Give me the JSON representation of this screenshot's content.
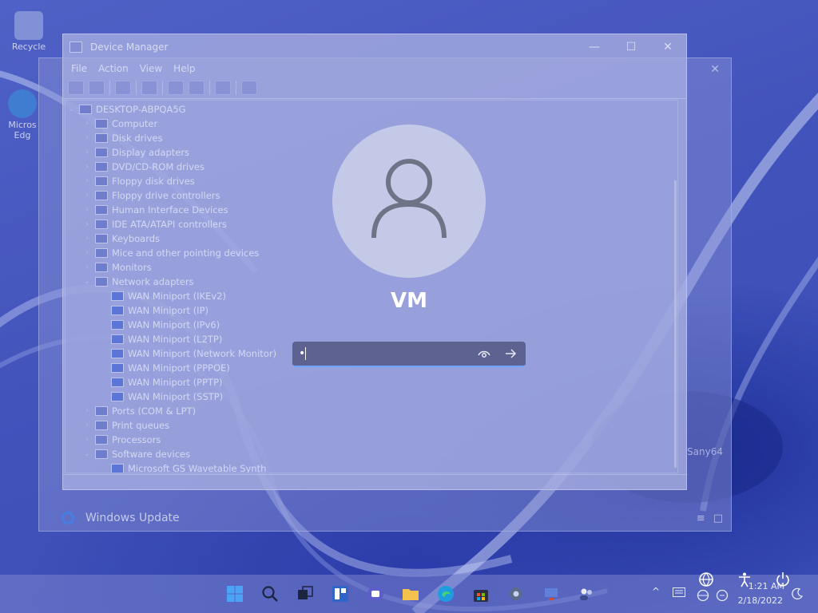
{
  "desktop": {
    "icons": [
      {
        "label": "Recycle"
      },
      {
        "label": "Micros Edg"
      }
    ]
  },
  "background_window": {
    "footer_label": "Windows Update",
    "side_text": "Sany64",
    "close_glyph": "✕",
    "corner_glyphs": [
      "≡",
      "□"
    ]
  },
  "device_manager": {
    "title": "Device Manager",
    "controls": {
      "minimize": "—",
      "maximize": "☐",
      "close": "✕"
    },
    "menu": [
      "File",
      "Action",
      "View",
      "Help"
    ],
    "tree": {
      "root": "DESKTOP-ABPQA5G",
      "items": [
        {
          "label": "Computer",
          "level": 1,
          "expander": "›"
        },
        {
          "label": "Disk drives",
          "level": 1,
          "expander": "›"
        },
        {
          "label": "Display adapters",
          "level": 1,
          "expander": "›"
        },
        {
          "label": "DVD/CD-ROM drives",
          "level": 1,
          "expander": "›"
        },
        {
          "label": "Floppy disk drives",
          "level": 1,
          "expander": "›"
        },
        {
          "label": "Floppy drive controllers",
          "level": 1,
          "expander": "›"
        },
        {
          "label": "Human Interface Devices",
          "level": 1,
          "expander": "›"
        },
        {
          "label": "IDE ATA/ATAPI controllers",
          "level": 1,
          "expander": "›"
        },
        {
          "label": "Keyboards",
          "level": 1,
          "expander": "›"
        },
        {
          "label": "Mice and other pointing devices",
          "level": 1,
          "expander": "›"
        },
        {
          "label": "Monitors",
          "level": 1,
          "expander": "›"
        },
        {
          "label": "Network adapters",
          "level": 1,
          "expander": "⌄"
        },
        {
          "label": "WAN Miniport (IKEv2)",
          "level": 2,
          "expander": ""
        },
        {
          "label": "WAN Miniport (IP)",
          "level": 2,
          "expander": ""
        },
        {
          "label": "WAN Miniport (IPv6)",
          "level": 2,
          "expander": ""
        },
        {
          "label": "WAN Miniport (L2TP)",
          "level": 2,
          "expander": ""
        },
        {
          "label": "WAN Miniport (Network Monitor)",
          "level": 2,
          "expander": ""
        },
        {
          "label": "WAN Miniport (PPPOE)",
          "level": 2,
          "expander": ""
        },
        {
          "label": "WAN Miniport (PPTP)",
          "level": 2,
          "expander": ""
        },
        {
          "label": "WAN Miniport (SSTP)",
          "level": 2,
          "expander": ""
        },
        {
          "label": "Ports (COM & LPT)",
          "level": 1,
          "expander": "›"
        },
        {
          "label": "Print queues",
          "level": 1,
          "expander": "›"
        },
        {
          "label": "Processors",
          "level": 1,
          "expander": "›"
        },
        {
          "label": "Software devices",
          "level": 1,
          "expander": "⌄"
        },
        {
          "label": "Microsoft GS Wavetable Synth",
          "level": 2,
          "expander": ""
        }
      ]
    }
  },
  "lock_screen": {
    "username": "VM",
    "password_masked": "•",
    "icons": {
      "avatar": "user-icon",
      "reveal": "eye-icon",
      "submit": "arrow-right-icon"
    },
    "accent": "#6fa3ff"
  },
  "taskbar": {
    "apps": [
      "windows-start-icon",
      "search-icon",
      "task-view-icon",
      "widgets-icon",
      "chat-icon",
      "file-explorer-icon",
      "edge-icon",
      "store-icon",
      "settings-icon",
      "device-manager-icon",
      "people-icon"
    ],
    "tray": {
      "chevron": "^",
      "clock_time": "1:21 AM",
      "clock_date": "2/18/2022"
    }
  },
  "lock_corner_icons": [
    "network-icon",
    "accessibility-icon",
    "power-icon"
  ]
}
